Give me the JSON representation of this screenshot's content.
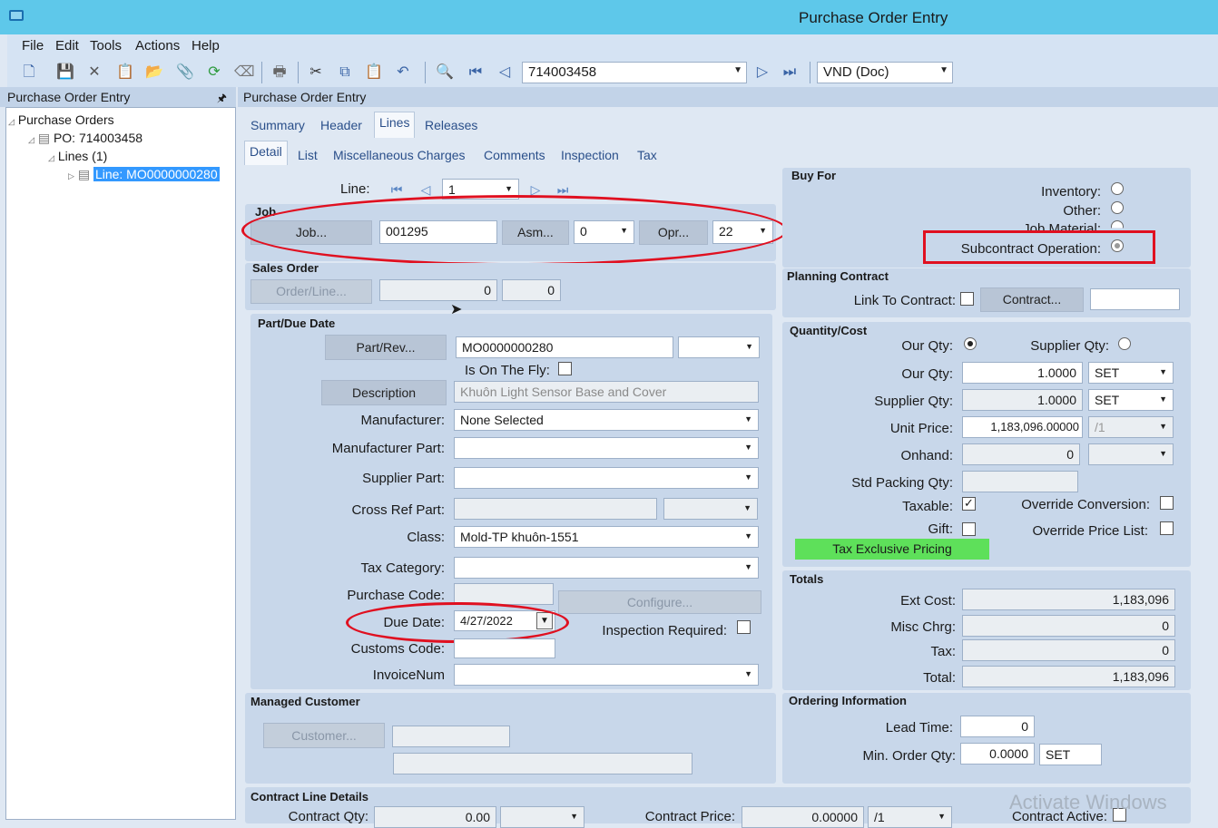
{
  "window": {
    "title": "Purchase Order Entry"
  },
  "menu": [
    "File",
    "Edit",
    "Tools",
    "Actions",
    "Help"
  ],
  "toolbar": {
    "po_number": "714003458",
    "currency": "VND (Doc)"
  },
  "left_panel": {
    "title": "Purchase Order Entry",
    "pin": "🖈",
    "tree": [
      "Purchase Orders",
      "PO: 714003458",
      "Lines (1)",
      "Line: MO0000000280"
    ]
  },
  "main_panel": {
    "title": "Purchase Order Entry"
  },
  "tabs": [
    "Summary",
    "Header",
    "Lines",
    "Releases"
  ],
  "subtabs": [
    "Detail",
    "List",
    "Miscellaneous Charges",
    "Comments",
    "Inspection",
    "Tax"
  ],
  "line": {
    "label": "Line:",
    "value": "1"
  },
  "job": {
    "section": "Job",
    "job_btn": "Job...",
    "job_value": "001295",
    "asm_btn": "Asm...",
    "asm_value": "0",
    "opr_btn": "Opr...",
    "opr_value": "22"
  },
  "sales_order": {
    "section": "Sales Order",
    "btn": "Order/Line...",
    "order": "0",
    "line": "0"
  },
  "part": {
    "section": "Part/Due Date",
    "partrev_btn": "Part/Rev...",
    "part_value": "MO0000000280",
    "rev_value": "",
    "onthefly_label": "Is On The Fly:",
    "desc_btn": "Description",
    "description": "Khuôn Light Sensor Base and Cover",
    "manufacturer_label": "Manufacturer:",
    "manufacturer_value": "None Selected",
    "mfgpart_label": "Manufacturer Part:",
    "supplier_part_label": "Supplier Part:",
    "crossref_label": "Cross Ref Part:",
    "class_label": "Class:",
    "class_value": "Mold-TP khuôn-1551",
    "taxcat_label": "Tax Category:",
    "purchcode_label": "Purchase Code:",
    "configure_btn": "Configure...",
    "duedate_label": "Due Date:",
    "duedate_value": "4/27/2022",
    "inspreq_label": "Inspection Required:",
    "customs_label": "Customs Code:",
    "invoice_label": "InvoiceNum"
  },
  "buy_for": {
    "section": "Buy For",
    "inventory": "Inventory:",
    "other": "Other:",
    "job_material": "Job Material:",
    "subcontract": "Subcontract Operation:"
  },
  "planning": {
    "section": "Planning Contract",
    "link_label": "Link To Contract:",
    "contract_btn": "Contract..."
  },
  "qty_cost": {
    "section": "Quantity/Cost",
    "our_qty_radio": "Our Qty:",
    "supplier_qty_radio": "Supplier Qty:",
    "our_qty_label": "Our Qty:",
    "our_qty": "1.0000",
    "our_uom": "SET",
    "supplier_qty_label": "Supplier Qty:",
    "supplier_qty": "1.0000",
    "supplier_uom": "SET",
    "unit_price_label": "Unit Price:",
    "unit_price": "1,183,096.00000",
    "price_per": "/1",
    "onhand_label": "Onhand:",
    "onhand": "0",
    "std_pack_label": "Std Packing Qty:",
    "taxable_label": "Taxable:",
    "override_conv_label": "Override Conversion:",
    "gift_label": "Gift:",
    "override_price_label": "Override Price List:",
    "tax_pricing": "Tax Exclusive Pricing"
  },
  "totals": {
    "section": "Totals",
    "ext_cost_label": "Ext Cost:",
    "ext_cost": "1,183,096",
    "misc_label": "Misc Chrg:",
    "misc": "0",
    "tax_label": "Tax:",
    "tax": "0",
    "total_label": "Total:",
    "total": "1,183,096"
  },
  "managed_customer": {
    "section": "Managed Customer",
    "btn": "Customer..."
  },
  "ordering": {
    "section": "Ordering Information",
    "lead_label": "Lead Time:",
    "lead": "0",
    "min_label": "Min. Order Qty:",
    "min": "0.0000",
    "min_uom": "SET"
  },
  "contract_line": {
    "section": "Contract Line Details",
    "qty_label": "Contract Qty:",
    "qty": "0.00",
    "price_label": "Contract Price:",
    "price": "0.00000",
    "per": "/1",
    "active_label": "Contract Active:"
  },
  "watermark": "Activate Windows"
}
